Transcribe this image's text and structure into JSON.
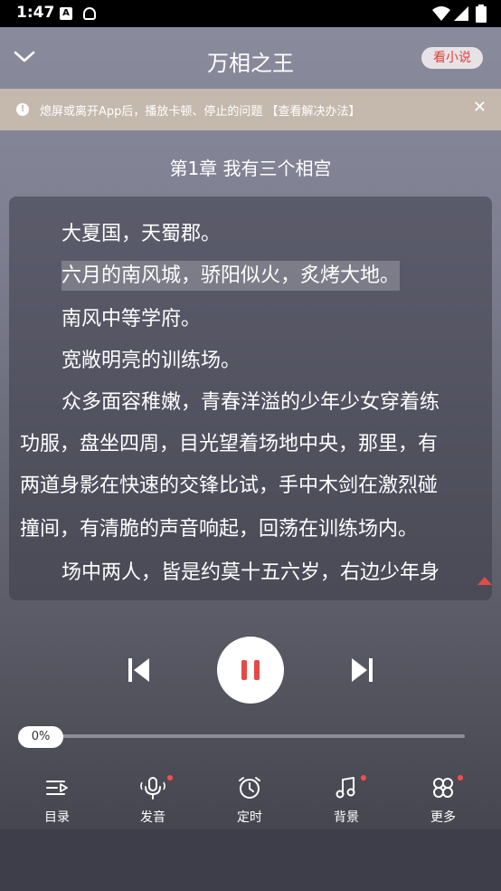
{
  "status_bar": {
    "time": "1:47"
  },
  "header": {
    "title": "万相之王",
    "novel_button": "看小说"
  },
  "notice": {
    "text": "熄屏或离开App后，播放卡顿、停止的问题 【查看解决办法】"
  },
  "chapter_title": "第1章 我有三个相宫",
  "content": [
    "大夏国，天蜀郡。",
    "六月的南风城，骄阳似火，炙烤大地。",
    "南风中等学府。",
    "宽敞明亮的训练场。",
    "众多面容稚嫩，青春洋溢的少年少女穿着练",
    "功服，盘坐四周，目光望着场地中央，那里，有",
    "两道身影在快速的交锋比试，手中木剑在激烈碰",
    "撞间，有清脆的声音响起，回荡在训练场内。",
    "场中两人，皆是约莫十五六岁，右边少年身"
  ],
  "player": {
    "progress_label": "0%",
    "progress_fraction": 0.0
  },
  "nav": [
    {
      "label": "目录",
      "icon": "list-icon"
    },
    {
      "label": "发音",
      "icon": "mic-icon"
    },
    {
      "label": "定时",
      "icon": "alarm-icon"
    },
    {
      "label": "背景",
      "icon": "music-icon"
    },
    {
      "label": "更多",
      "icon": "more-icon"
    }
  ],
  "colors": {
    "accent": "#e44a47",
    "notice_bg": "#c5b8ad"
  }
}
